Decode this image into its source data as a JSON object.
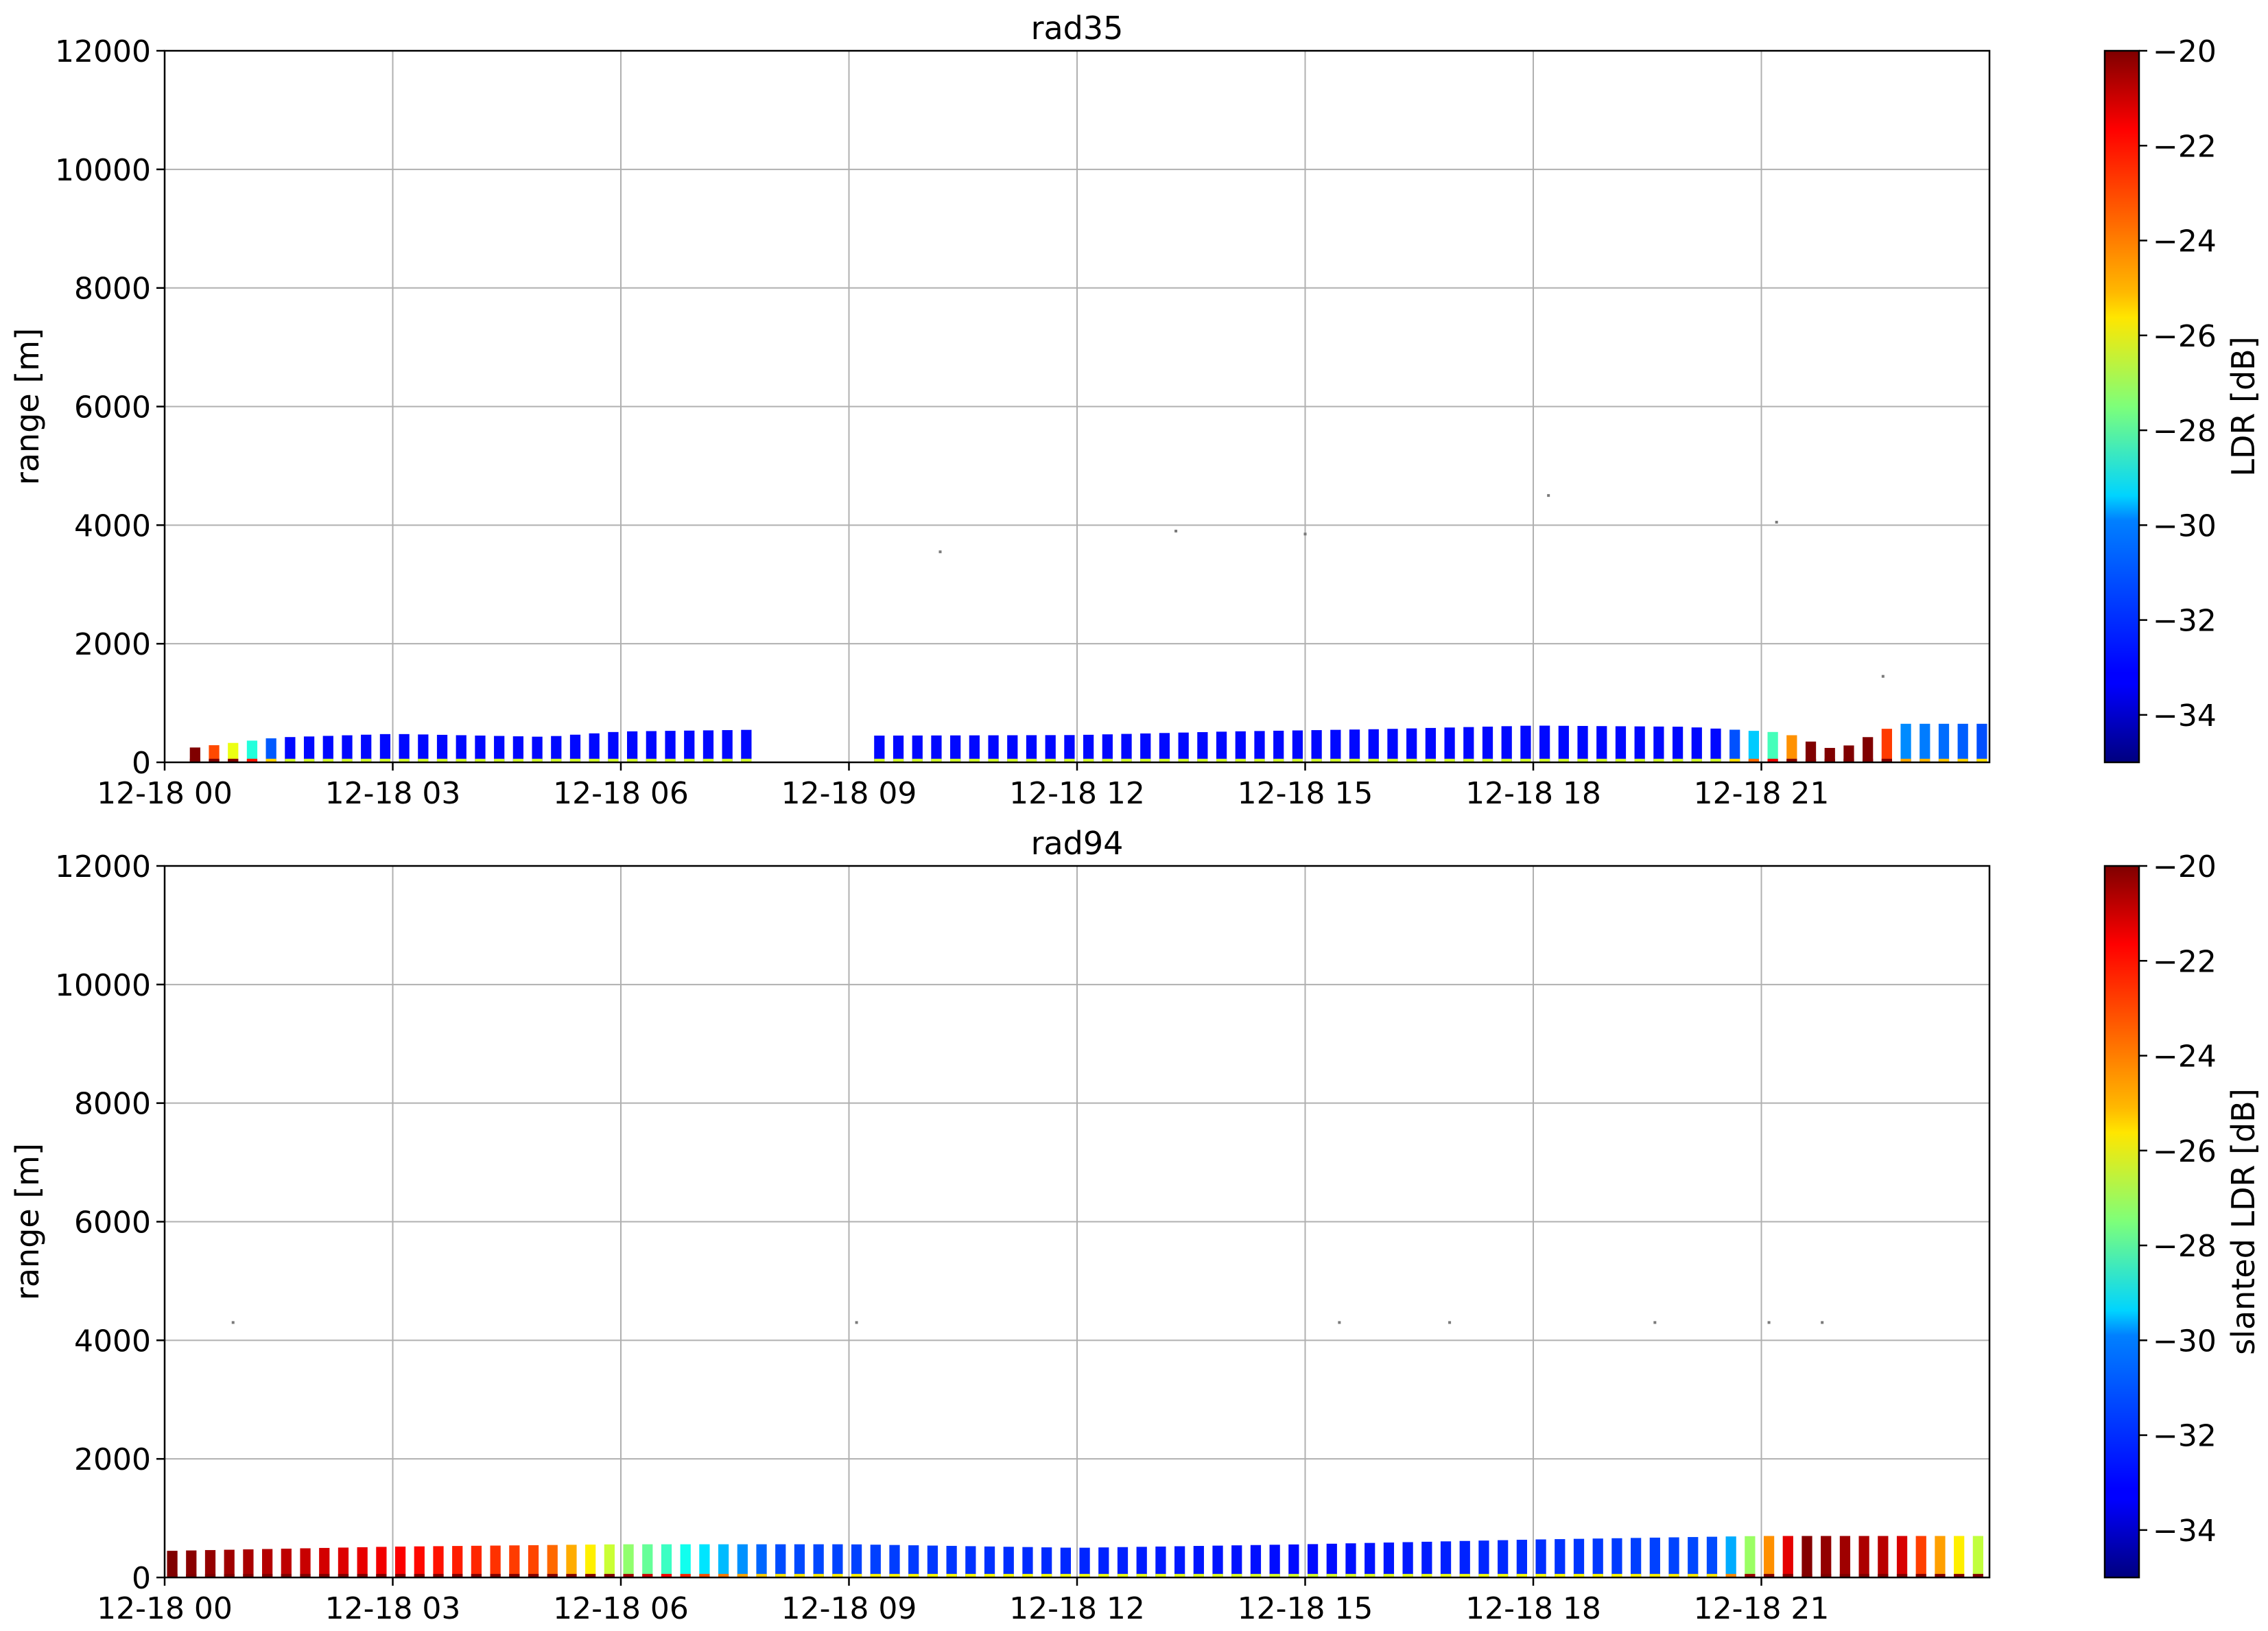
{
  "chart_data": [
    {
      "type": "heatmap",
      "title": "rad35",
      "xlabel": "",
      "ylabel": "range [m]",
      "ylim": [
        0,
        12000
      ],
      "yticks": [
        "0",
        "2000",
        "4000",
        "6000",
        "8000",
        "10000",
        "12000"
      ],
      "xlim_hours": [
        0,
        24
      ],
      "xticks": [
        {
          "hour": 0,
          "label": "12-18 00"
        },
        {
          "hour": 3,
          "label": "12-18 03"
        },
        {
          "hour": 6,
          "label": "12-18 06"
        },
        {
          "hour": 9,
          "label": "12-18 09"
        },
        {
          "hour": 12,
          "label": "12-18 12"
        },
        {
          "hour": 15,
          "label": "12-18 15"
        },
        {
          "hour": 18,
          "label": "12-18 18"
        },
        {
          "hour": 21,
          "label": "12-18 21"
        }
      ],
      "grid": true,
      "colorbar": {
        "label": "LDR [dB]",
        "range": [
          -35,
          -20
        ],
        "ticks": [
          "−20",
          "−22",
          "−24",
          "−26",
          "−28",
          "−30",
          "−32",
          "−34"
        ],
        "colormap": "jet"
      },
      "columns": {
        "start_hour": 0.4,
        "end_hour": 23.95,
        "step_hour": 0.25,
        "gaps_hours": [
          [
            7.8,
            9.3
          ]
        ],
        "top_range_m": [
          [
            0.4,
            250
          ],
          [
            1.5,
            420
          ],
          [
            3.0,
            480
          ],
          [
            5.0,
            430
          ],
          [
            6.0,
            520
          ],
          [
            7.8,
            550
          ],
          [
            9.3,
            450
          ],
          [
            12.0,
            460
          ],
          [
            14.0,
            520
          ],
          [
            16.0,
            560
          ],
          [
            18.0,
            620
          ],
          [
            20.0,
            600
          ],
          [
            21.3,
            500
          ],
          [
            22.0,
            200
          ],
          [
            22.8,
            650
          ],
          [
            23.95,
            650
          ]
        ],
        "ldr_db": [
          [
            0.4,
            -20
          ],
          [
            1.5,
            -33
          ],
          [
            7.8,
            -33
          ],
          [
            9.3,
            -33
          ],
          [
            20.5,
            -33
          ],
          [
            21.2,
            -28
          ],
          [
            21.6,
            -20
          ],
          [
            22.6,
            -20
          ],
          [
            22.8,
            -31
          ],
          [
            23.95,
            -32
          ]
        ]
      },
      "specks": [
        {
          "hour": 10.2,
          "range_m": 3550
        },
        {
          "hour": 13.3,
          "range_m": 3900
        },
        {
          "hour": 15.0,
          "range_m": 3850
        },
        {
          "hour": 18.2,
          "range_m": 4500
        },
        {
          "hour": 21.2,
          "range_m": 4050
        },
        {
          "hour": 22.6,
          "range_m": 1450
        }
      ]
    },
    {
      "type": "heatmap",
      "title": "rad94",
      "xlabel": "",
      "ylabel": "range [m]",
      "ylim": [
        0,
        12000
      ],
      "yticks": [
        "0",
        "2000",
        "4000",
        "6000",
        "8000",
        "10000",
        "12000"
      ],
      "xlim_hours": [
        0,
        24
      ],
      "xticks": [
        {
          "hour": 0,
          "label": "12-18 00"
        },
        {
          "hour": 3,
          "label": "12-18 03"
        },
        {
          "hour": 6,
          "label": "12-18 06"
        },
        {
          "hour": 9,
          "label": "12-18 09"
        },
        {
          "hour": 12,
          "label": "12-18 12"
        },
        {
          "hour": 15,
          "label": "12-18 15"
        },
        {
          "hour": 18,
          "label": "12-18 18"
        },
        {
          "hour": 21,
          "label": "12-18 21"
        }
      ],
      "grid": true,
      "colorbar": {
        "label": "slanted LDR [dB]",
        "range": [
          -35,
          -20
        ],
        "ticks": [
          "−20",
          "−22",
          "−24",
          "−26",
          "−28",
          "−30",
          "−32",
          "−34"
        ],
        "colormap": "jet"
      },
      "columns": {
        "start_hour": 0.1,
        "end_hour": 23.95,
        "step_hour": 0.25,
        "gaps_hours": [],
        "top_range_m": [
          [
            0.1,
            450
          ],
          [
            3.0,
            520
          ],
          [
            6.0,
            560
          ],
          [
            9.0,
            560
          ],
          [
            12.0,
            500
          ],
          [
            15.0,
            560
          ],
          [
            18.0,
            640
          ],
          [
            21.0,
            700
          ],
          [
            23.95,
            700
          ]
        ],
        "ldr_db": [
          [
            0.1,
            -20
          ],
          [
            5.0,
            -23
          ],
          [
            6.0,
            -27
          ],
          [
            7.2,
            -30
          ],
          [
            8.0,
            -32
          ],
          [
            15.0,
            -33
          ],
          [
            20.5,
            -32
          ],
          [
            21.0,
            -25
          ],
          [
            21.5,
            -20
          ],
          [
            22.8,
            -21
          ],
          [
            23.3,
            -24
          ],
          [
            23.95,
            -27
          ]
        ]
      },
      "specks": [
        {
          "hour": 0.9,
          "range_m": 4300
        },
        {
          "hour": 9.1,
          "range_m": 4300
        },
        {
          "hour": 15.45,
          "range_m": 4300
        },
        {
          "hour": 16.9,
          "range_m": 4300
        },
        {
          "hour": 19.6,
          "range_m": 4300
        },
        {
          "hour": 21.1,
          "range_m": 4300
        },
        {
          "hour": 21.8,
          "range_m": 4300
        }
      ]
    }
  ]
}
